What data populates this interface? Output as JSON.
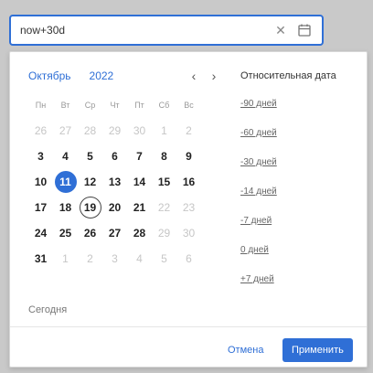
{
  "input": {
    "value": "now+30d",
    "clear_icon": "✕"
  },
  "calendar": {
    "month_label": "Октябрь",
    "year_label": "2022",
    "prev": "‹",
    "next": "›",
    "weekdays": [
      "Пн",
      "Вт",
      "Ср",
      "Чт",
      "Пт",
      "Сб",
      "Вс"
    ],
    "weeks": [
      [
        "26",
        "27",
        "28",
        "29",
        "30",
        "1",
        "2"
      ],
      [
        "3",
        "4",
        "5",
        "6",
        "7",
        "8",
        "9"
      ],
      [
        "10",
        "11",
        "12",
        "13",
        "14",
        "15",
        "16"
      ],
      [
        "17",
        "18",
        "19",
        "20",
        "21",
        "22",
        "23"
      ],
      [
        "24",
        "25",
        "26",
        "27",
        "28",
        "29",
        "30"
      ],
      [
        "31",
        "1",
        "2",
        "3",
        "4",
        "5",
        "6"
      ]
    ],
    "selected_day": "11",
    "today_day": "19",
    "today_link": "Сегодня"
  },
  "relative": {
    "title": "Относительная дата",
    "options": [
      "-90 дней",
      "-60 дней",
      "-30 дней",
      "-14 дней",
      "-7 дней",
      "0 дней",
      "+7 дней"
    ]
  },
  "footer": {
    "cancel": "Отмена",
    "apply": "Применить"
  }
}
